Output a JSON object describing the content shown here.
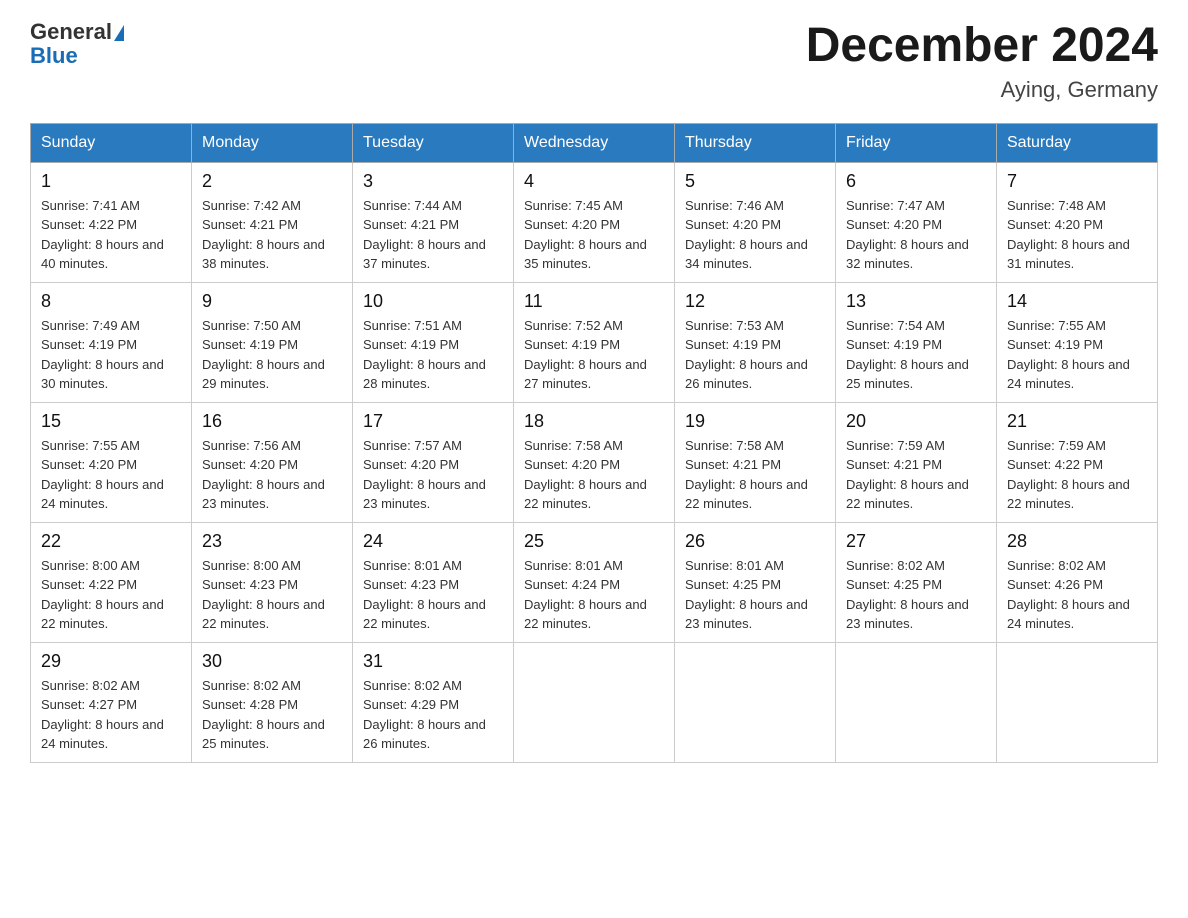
{
  "logo": {
    "general": "General",
    "blue": "Blue"
  },
  "title": "December 2024",
  "subtitle": "Aying, Germany",
  "days_header": [
    "Sunday",
    "Monday",
    "Tuesday",
    "Wednesday",
    "Thursday",
    "Friday",
    "Saturday"
  ],
  "weeks": [
    [
      {
        "day": "1",
        "sunrise": "7:41 AM",
        "sunset": "4:22 PM",
        "daylight": "8 hours and 40 minutes."
      },
      {
        "day": "2",
        "sunrise": "7:42 AM",
        "sunset": "4:21 PM",
        "daylight": "8 hours and 38 minutes."
      },
      {
        "day": "3",
        "sunrise": "7:44 AM",
        "sunset": "4:21 PM",
        "daylight": "8 hours and 37 minutes."
      },
      {
        "day": "4",
        "sunrise": "7:45 AM",
        "sunset": "4:20 PM",
        "daylight": "8 hours and 35 minutes."
      },
      {
        "day": "5",
        "sunrise": "7:46 AM",
        "sunset": "4:20 PM",
        "daylight": "8 hours and 34 minutes."
      },
      {
        "day": "6",
        "sunrise": "7:47 AM",
        "sunset": "4:20 PM",
        "daylight": "8 hours and 32 minutes."
      },
      {
        "day": "7",
        "sunrise": "7:48 AM",
        "sunset": "4:20 PM",
        "daylight": "8 hours and 31 minutes."
      }
    ],
    [
      {
        "day": "8",
        "sunrise": "7:49 AM",
        "sunset": "4:19 PM",
        "daylight": "8 hours and 30 minutes."
      },
      {
        "day": "9",
        "sunrise": "7:50 AM",
        "sunset": "4:19 PM",
        "daylight": "8 hours and 29 minutes."
      },
      {
        "day": "10",
        "sunrise": "7:51 AM",
        "sunset": "4:19 PM",
        "daylight": "8 hours and 28 minutes."
      },
      {
        "day": "11",
        "sunrise": "7:52 AM",
        "sunset": "4:19 PM",
        "daylight": "8 hours and 27 minutes."
      },
      {
        "day": "12",
        "sunrise": "7:53 AM",
        "sunset": "4:19 PM",
        "daylight": "8 hours and 26 minutes."
      },
      {
        "day": "13",
        "sunrise": "7:54 AM",
        "sunset": "4:19 PM",
        "daylight": "8 hours and 25 minutes."
      },
      {
        "day": "14",
        "sunrise": "7:55 AM",
        "sunset": "4:19 PM",
        "daylight": "8 hours and 24 minutes."
      }
    ],
    [
      {
        "day": "15",
        "sunrise": "7:55 AM",
        "sunset": "4:20 PM",
        "daylight": "8 hours and 24 minutes."
      },
      {
        "day": "16",
        "sunrise": "7:56 AM",
        "sunset": "4:20 PM",
        "daylight": "8 hours and 23 minutes."
      },
      {
        "day": "17",
        "sunrise": "7:57 AM",
        "sunset": "4:20 PM",
        "daylight": "8 hours and 23 minutes."
      },
      {
        "day": "18",
        "sunrise": "7:58 AM",
        "sunset": "4:20 PM",
        "daylight": "8 hours and 22 minutes."
      },
      {
        "day": "19",
        "sunrise": "7:58 AM",
        "sunset": "4:21 PM",
        "daylight": "8 hours and 22 minutes."
      },
      {
        "day": "20",
        "sunrise": "7:59 AM",
        "sunset": "4:21 PM",
        "daylight": "8 hours and 22 minutes."
      },
      {
        "day": "21",
        "sunrise": "7:59 AM",
        "sunset": "4:22 PM",
        "daylight": "8 hours and 22 minutes."
      }
    ],
    [
      {
        "day": "22",
        "sunrise": "8:00 AM",
        "sunset": "4:22 PM",
        "daylight": "8 hours and 22 minutes."
      },
      {
        "day": "23",
        "sunrise": "8:00 AM",
        "sunset": "4:23 PM",
        "daylight": "8 hours and 22 minutes."
      },
      {
        "day": "24",
        "sunrise": "8:01 AM",
        "sunset": "4:23 PM",
        "daylight": "8 hours and 22 minutes."
      },
      {
        "day": "25",
        "sunrise": "8:01 AM",
        "sunset": "4:24 PM",
        "daylight": "8 hours and 22 minutes."
      },
      {
        "day": "26",
        "sunrise": "8:01 AM",
        "sunset": "4:25 PM",
        "daylight": "8 hours and 23 minutes."
      },
      {
        "day": "27",
        "sunrise": "8:02 AM",
        "sunset": "4:25 PM",
        "daylight": "8 hours and 23 minutes."
      },
      {
        "day": "28",
        "sunrise": "8:02 AM",
        "sunset": "4:26 PM",
        "daylight": "8 hours and 24 minutes."
      }
    ],
    [
      {
        "day": "29",
        "sunrise": "8:02 AM",
        "sunset": "4:27 PM",
        "daylight": "8 hours and 24 minutes."
      },
      {
        "day": "30",
        "sunrise": "8:02 AM",
        "sunset": "4:28 PM",
        "daylight": "8 hours and 25 minutes."
      },
      {
        "day": "31",
        "sunrise": "8:02 AM",
        "sunset": "4:29 PM",
        "daylight": "8 hours and 26 minutes."
      },
      null,
      null,
      null,
      null
    ]
  ]
}
